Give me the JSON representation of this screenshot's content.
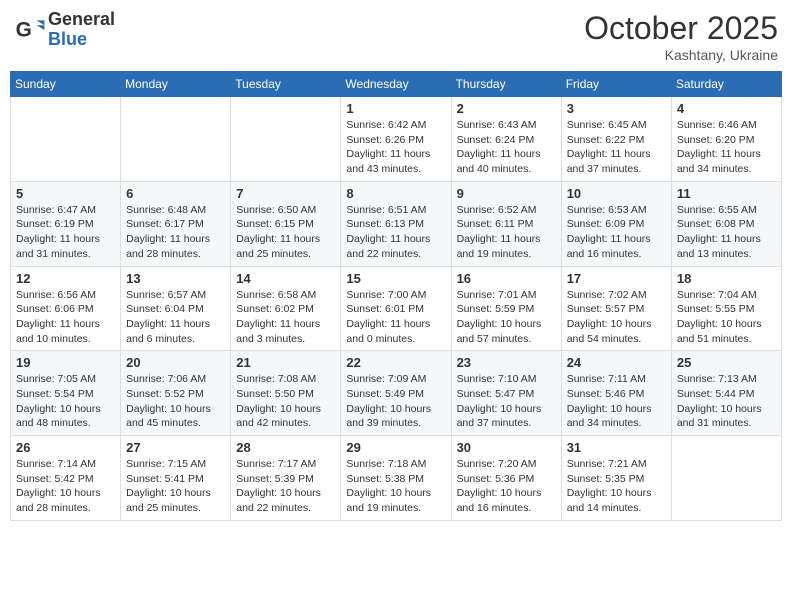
{
  "logo": {
    "general": "General",
    "blue": "Blue"
  },
  "header": {
    "month": "October 2025",
    "location": "Kashtany, Ukraine"
  },
  "weekdays": [
    "Sunday",
    "Monday",
    "Tuesday",
    "Wednesday",
    "Thursday",
    "Friday",
    "Saturday"
  ],
  "weeks": [
    [
      {
        "day": "",
        "info": ""
      },
      {
        "day": "",
        "info": ""
      },
      {
        "day": "",
        "info": ""
      },
      {
        "day": "1",
        "info": "Sunrise: 6:42 AM\nSunset: 6:26 PM\nDaylight: 11 hours\nand 43 minutes."
      },
      {
        "day": "2",
        "info": "Sunrise: 6:43 AM\nSunset: 6:24 PM\nDaylight: 11 hours\nand 40 minutes."
      },
      {
        "day": "3",
        "info": "Sunrise: 6:45 AM\nSunset: 6:22 PM\nDaylight: 11 hours\nand 37 minutes."
      },
      {
        "day": "4",
        "info": "Sunrise: 6:46 AM\nSunset: 6:20 PM\nDaylight: 11 hours\nand 34 minutes."
      }
    ],
    [
      {
        "day": "5",
        "info": "Sunrise: 6:47 AM\nSunset: 6:19 PM\nDaylight: 11 hours\nand 31 minutes."
      },
      {
        "day": "6",
        "info": "Sunrise: 6:48 AM\nSunset: 6:17 PM\nDaylight: 11 hours\nand 28 minutes."
      },
      {
        "day": "7",
        "info": "Sunrise: 6:50 AM\nSunset: 6:15 PM\nDaylight: 11 hours\nand 25 minutes."
      },
      {
        "day": "8",
        "info": "Sunrise: 6:51 AM\nSunset: 6:13 PM\nDaylight: 11 hours\nand 22 minutes."
      },
      {
        "day": "9",
        "info": "Sunrise: 6:52 AM\nSunset: 6:11 PM\nDaylight: 11 hours\nand 19 minutes."
      },
      {
        "day": "10",
        "info": "Sunrise: 6:53 AM\nSunset: 6:09 PM\nDaylight: 11 hours\nand 16 minutes."
      },
      {
        "day": "11",
        "info": "Sunrise: 6:55 AM\nSunset: 6:08 PM\nDaylight: 11 hours\nand 13 minutes."
      }
    ],
    [
      {
        "day": "12",
        "info": "Sunrise: 6:56 AM\nSunset: 6:06 PM\nDaylight: 11 hours\nand 10 minutes."
      },
      {
        "day": "13",
        "info": "Sunrise: 6:57 AM\nSunset: 6:04 PM\nDaylight: 11 hours\nand 6 minutes."
      },
      {
        "day": "14",
        "info": "Sunrise: 6:58 AM\nSunset: 6:02 PM\nDaylight: 11 hours\nand 3 minutes."
      },
      {
        "day": "15",
        "info": "Sunrise: 7:00 AM\nSunset: 6:01 PM\nDaylight: 11 hours\nand 0 minutes."
      },
      {
        "day": "16",
        "info": "Sunrise: 7:01 AM\nSunset: 5:59 PM\nDaylight: 10 hours\nand 57 minutes."
      },
      {
        "day": "17",
        "info": "Sunrise: 7:02 AM\nSunset: 5:57 PM\nDaylight: 10 hours\nand 54 minutes."
      },
      {
        "day": "18",
        "info": "Sunrise: 7:04 AM\nSunset: 5:55 PM\nDaylight: 10 hours\nand 51 minutes."
      }
    ],
    [
      {
        "day": "19",
        "info": "Sunrise: 7:05 AM\nSunset: 5:54 PM\nDaylight: 10 hours\nand 48 minutes."
      },
      {
        "day": "20",
        "info": "Sunrise: 7:06 AM\nSunset: 5:52 PM\nDaylight: 10 hours\nand 45 minutes."
      },
      {
        "day": "21",
        "info": "Sunrise: 7:08 AM\nSunset: 5:50 PM\nDaylight: 10 hours\nand 42 minutes."
      },
      {
        "day": "22",
        "info": "Sunrise: 7:09 AM\nSunset: 5:49 PM\nDaylight: 10 hours\nand 39 minutes."
      },
      {
        "day": "23",
        "info": "Sunrise: 7:10 AM\nSunset: 5:47 PM\nDaylight: 10 hours\nand 37 minutes."
      },
      {
        "day": "24",
        "info": "Sunrise: 7:11 AM\nSunset: 5:46 PM\nDaylight: 10 hours\nand 34 minutes."
      },
      {
        "day": "25",
        "info": "Sunrise: 7:13 AM\nSunset: 5:44 PM\nDaylight: 10 hours\nand 31 minutes."
      }
    ],
    [
      {
        "day": "26",
        "info": "Sunrise: 7:14 AM\nSunset: 5:42 PM\nDaylight: 10 hours\nand 28 minutes."
      },
      {
        "day": "27",
        "info": "Sunrise: 7:15 AM\nSunset: 5:41 PM\nDaylight: 10 hours\nand 25 minutes."
      },
      {
        "day": "28",
        "info": "Sunrise: 7:17 AM\nSunset: 5:39 PM\nDaylight: 10 hours\nand 22 minutes."
      },
      {
        "day": "29",
        "info": "Sunrise: 7:18 AM\nSunset: 5:38 PM\nDaylight: 10 hours\nand 19 minutes."
      },
      {
        "day": "30",
        "info": "Sunrise: 7:20 AM\nSunset: 5:36 PM\nDaylight: 10 hours\nand 16 minutes."
      },
      {
        "day": "31",
        "info": "Sunrise: 7:21 AM\nSunset: 5:35 PM\nDaylight: 10 hours\nand 14 minutes."
      },
      {
        "day": "",
        "info": ""
      }
    ]
  ]
}
